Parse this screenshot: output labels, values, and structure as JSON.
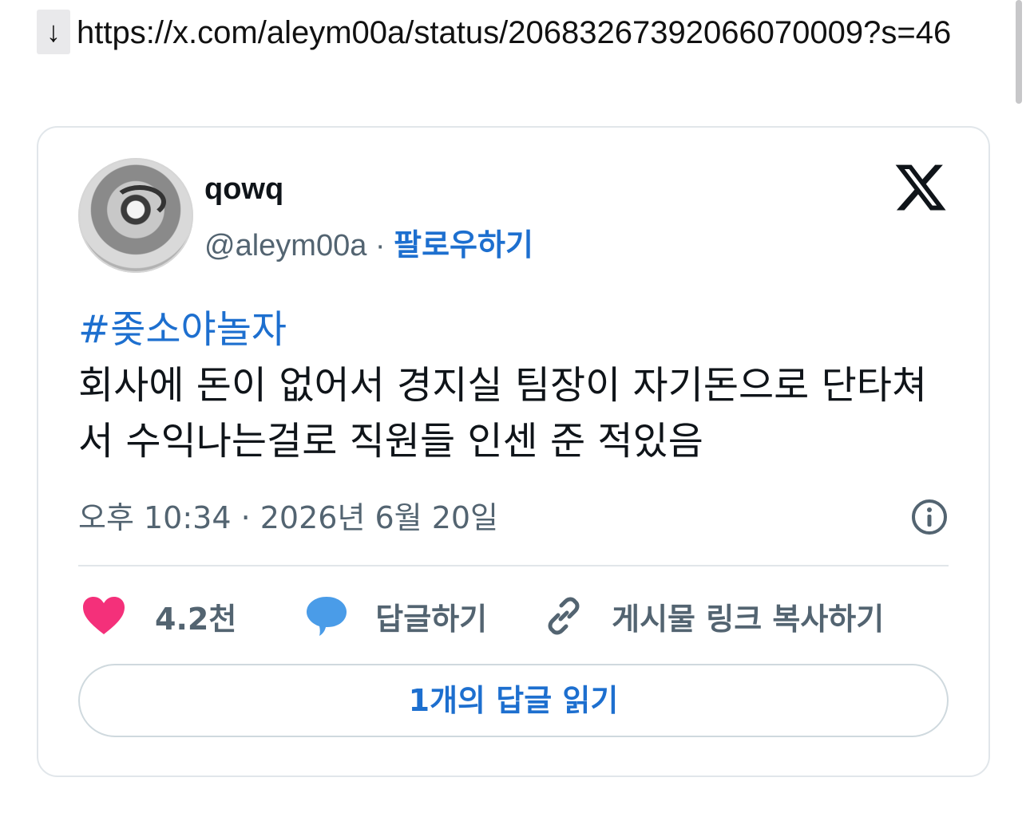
{
  "link": {
    "arrow": "↓",
    "url": "https://x.com/aleym00a/status/20683267392066070009?s=46"
  },
  "tweet": {
    "author_name": "qowq",
    "handle": "@aleym00a",
    "separator": " · ",
    "follow_label": "팔로우하기",
    "hashtag": "#좆소야놀자",
    "body": "회사에 돈이 없어서 경지실 팀장이 자기돈으로 단타쳐서 수익나는걸로 직원들 인센 준 적있음",
    "timestamp": "오후 10:34 · 2026년 6월 20일",
    "like_count": "4.2천",
    "reply_label": "답글하기",
    "copy_link_label": "게시물 링크 복사하기",
    "read_replies_label": "1개의 답글 읽기"
  },
  "icons": {
    "like": "heart-icon",
    "reply": "speech-bubble-icon",
    "copy": "link-icon",
    "brand": "x-logo-icon",
    "info": "info-icon"
  },
  "colors": {
    "accent": "#1d6fcf",
    "like": "#f4307a",
    "reply": "#4a9ce8",
    "muted": "#536471",
    "border": "#e1e6ea"
  }
}
